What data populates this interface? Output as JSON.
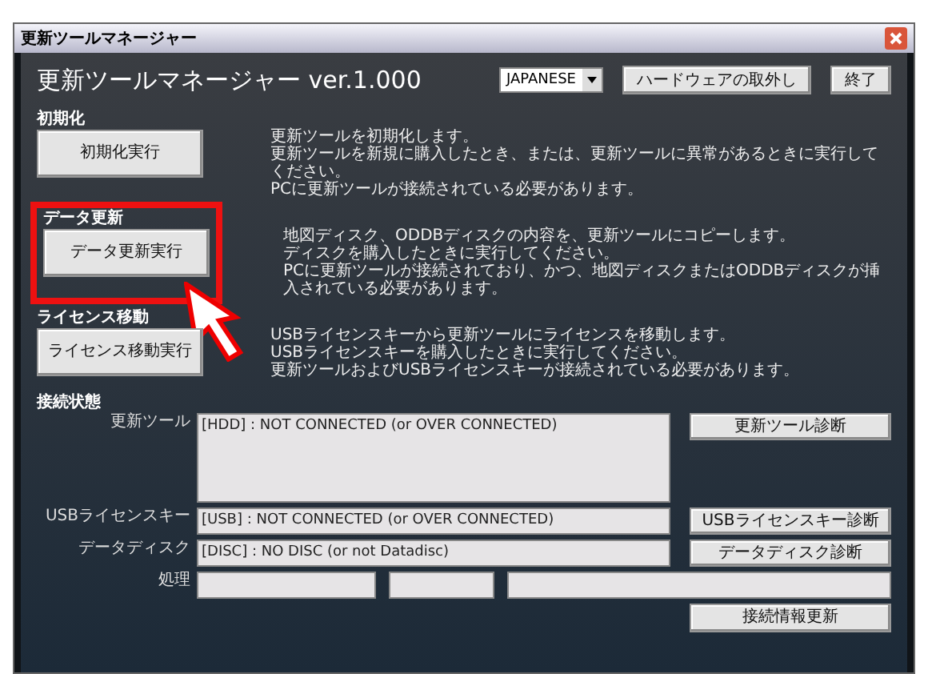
{
  "window": {
    "title": "更新ツールマネージャー"
  },
  "header": {
    "title": "更新ツールマネージャー ver.1.000",
    "language": "JAPANESE",
    "buttons": [
      "ハードウェアの取外し",
      "終了"
    ]
  },
  "sections": [
    {
      "heading": "初期化",
      "button": "初期化実行",
      "highlighted": false,
      "lines": [
        "更新ツールを初期化します。",
        "更新ツールを新規に購入したとき、または、更新ツールに異常があるときに実行してください。",
        "PCに更新ツールが接続されている必要があります。"
      ]
    },
    {
      "heading": "データ更新",
      "button": "データ更新実行",
      "highlighted": true,
      "lines": [
        "地図ディスク、ODDBディスクの内容を、更新ツールにコピーします。",
        "ディスクを購入したときに実行してください。",
        "PCに更新ツールが接続されており、かつ、地図ディスクまたはODDBディスクが挿入されている必要があります。"
      ]
    },
    {
      "heading": "ライセンス移動",
      "button": "ライセンス移動実行",
      "highlighted": false,
      "lines": [
        "USBライセンスキーから更新ツールにライセンスを移動します。",
        "USBライセンスキーを購入したときに実行してください。",
        "更新ツールおよびUSBライセンスキーが接続されている必要があります。"
      ]
    }
  ],
  "status": {
    "heading": "接続状態",
    "rows": [
      {
        "kind": "large",
        "label": "更新ツール",
        "value": "[HDD] : NOT CONNECTED (or OVER CONNECTED)",
        "button": "更新ツール診断"
      },
      {
        "kind": "line",
        "label": "USBライセンスキー",
        "value": "[USB] : NOT CONNECTED (or OVER CONNECTED)",
        "button": "USBライセンスキー診断"
      },
      {
        "kind": "line",
        "label": "データディスク",
        "value": "[DISC] : NO DISC (or not Datadisc)",
        "button": "データディスク診断"
      }
    ],
    "process_label": "処理",
    "refresh_button": "接続情報更新"
  }
}
